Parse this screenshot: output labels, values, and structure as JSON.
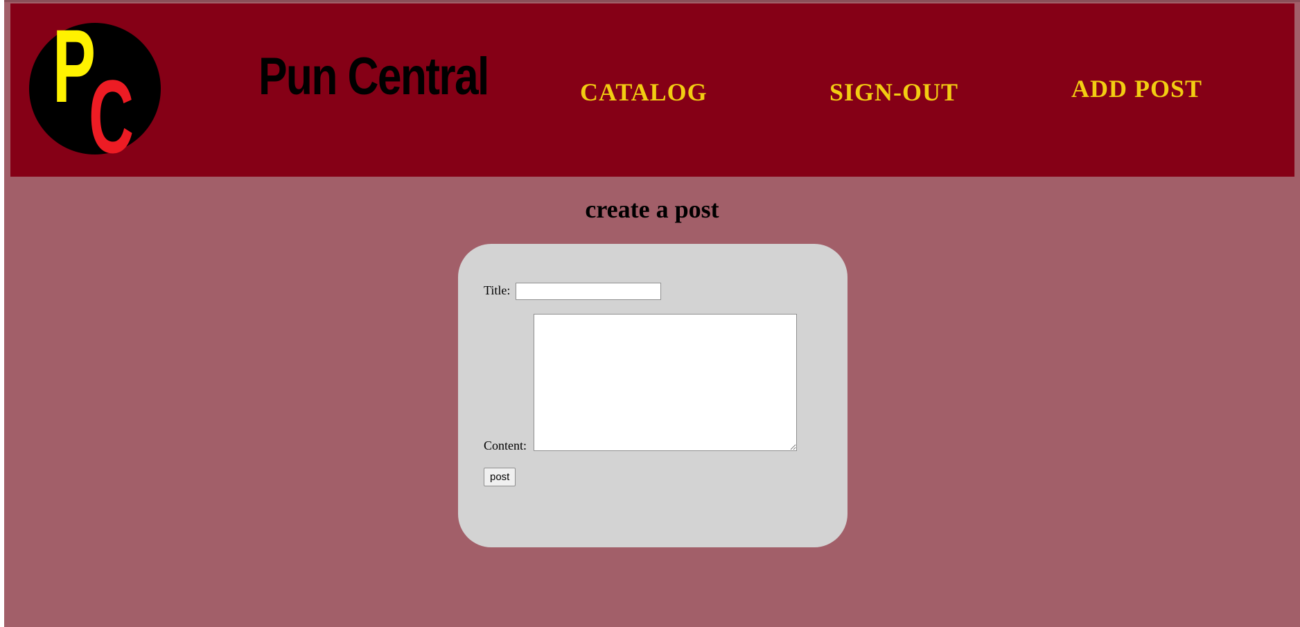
{
  "logo": {
    "letters": [
      "P",
      "C"
    ]
  },
  "header": {
    "site_title": "Pun Central",
    "nav": {
      "catalog": "CATALOG",
      "signout": "SIGN-OUT",
      "addpost": "ADD POST"
    }
  },
  "main": {
    "heading": "create a post",
    "form": {
      "title_label": "Title:",
      "title_value": "",
      "content_label": "Content:",
      "content_value": "",
      "submit_label": "post"
    }
  },
  "colors": {
    "header_bg": "#850016",
    "page_bg": "#a25f69",
    "nav_text": "#f2cd12",
    "card_bg": "#d3d3d3",
    "logo_p": "#fff200",
    "logo_c": "#ed1c24"
  }
}
